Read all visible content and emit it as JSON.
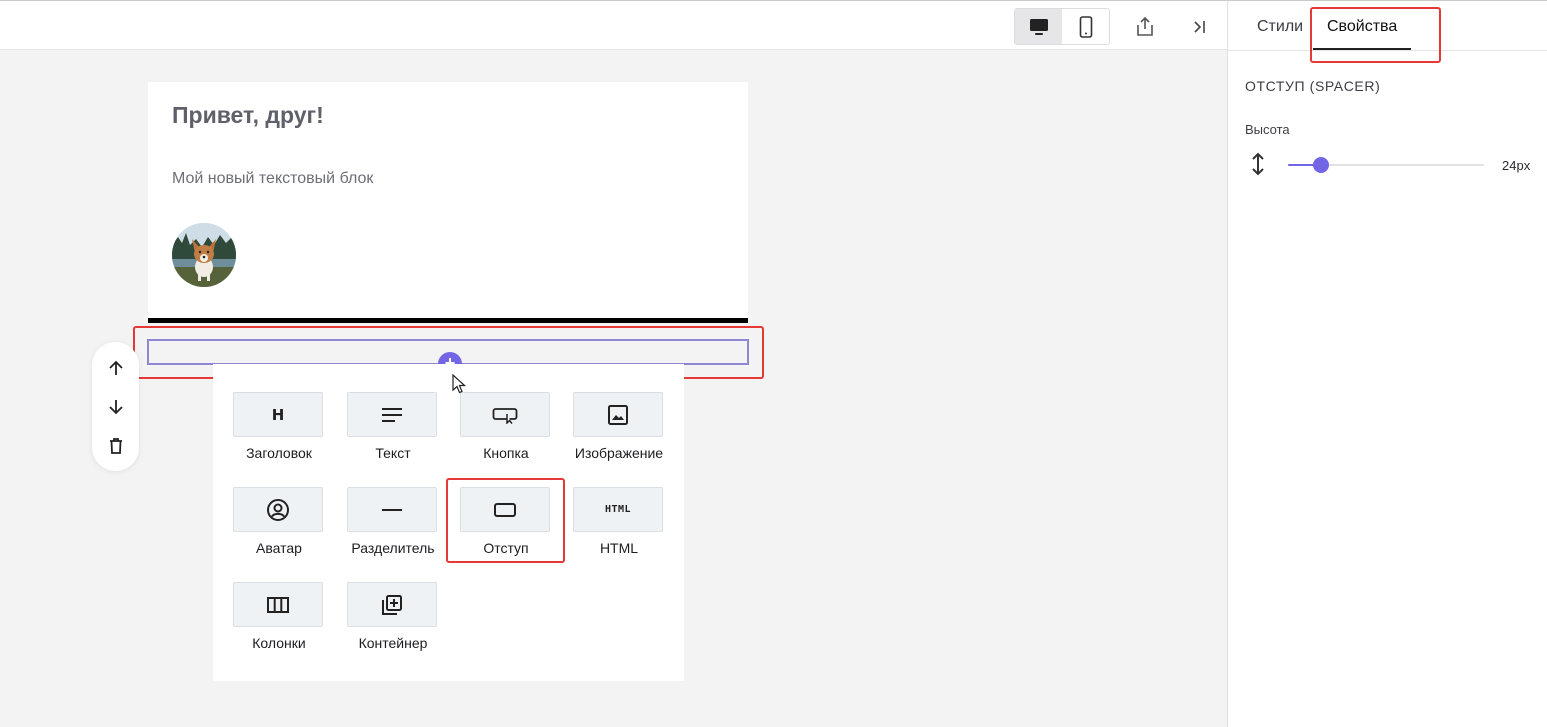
{
  "toolbar": {
    "devices": [
      {
        "name": "desktop",
        "icon": "desktop-icon",
        "active": true
      },
      {
        "name": "mobile",
        "icon": "mobile-icon",
        "active": false
      }
    ],
    "export_icon": "share-export-icon",
    "collapse_icon": "collapse-panel-icon"
  },
  "panel": {
    "tabs": [
      {
        "label": "Стили",
        "active": false
      },
      {
        "label": "Свойства",
        "active": true
      }
    ],
    "section_title": "ОТСТУП (SPACER)",
    "height_label": "Высота",
    "height_value": "24px",
    "slider_fraction": 0.17
  },
  "canvas": {
    "heading": "Привет, друг!",
    "text": "Мой новый текстовый блок",
    "avatar_icon": "dog-avatar-image",
    "add_symbol": "+"
  },
  "floating_actions": [
    {
      "name": "move-up",
      "icon": "arrow-up-icon"
    },
    {
      "name": "move-down",
      "icon": "arrow-down-icon"
    },
    {
      "name": "delete",
      "icon": "trash-icon"
    }
  ],
  "palette": {
    "items": [
      {
        "label": "Заголовок",
        "icon": "heading-icon"
      },
      {
        "label": "Текст",
        "icon": "text-icon"
      },
      {
        "label": "Кнопка",
        "icon": "button-icon"
      },
      {
        "label": "Изображение",
        "icon": "image-icon"
      },
      {
        "label": "Аватар",
        "icon": "avatar-icon"
      },
      {
        "label": "Разделитель",
        "icon": "divider-icon"
      },
      {
        "label": "Отступ",
        "icon": "spacer-icon"
      },
      {
        "label": "HTML",
        "icon": "html-icon"
      },
      {
        "label": "Колонки",
        "icon": "columns-icon"
      },
      {
        "label": "Контейнер",
        "icon": "container-icon"
      }
    ]
  },
  "colors": {
    "accent": "#7366e4",
    "highlight": "#e53935"
  }
}
